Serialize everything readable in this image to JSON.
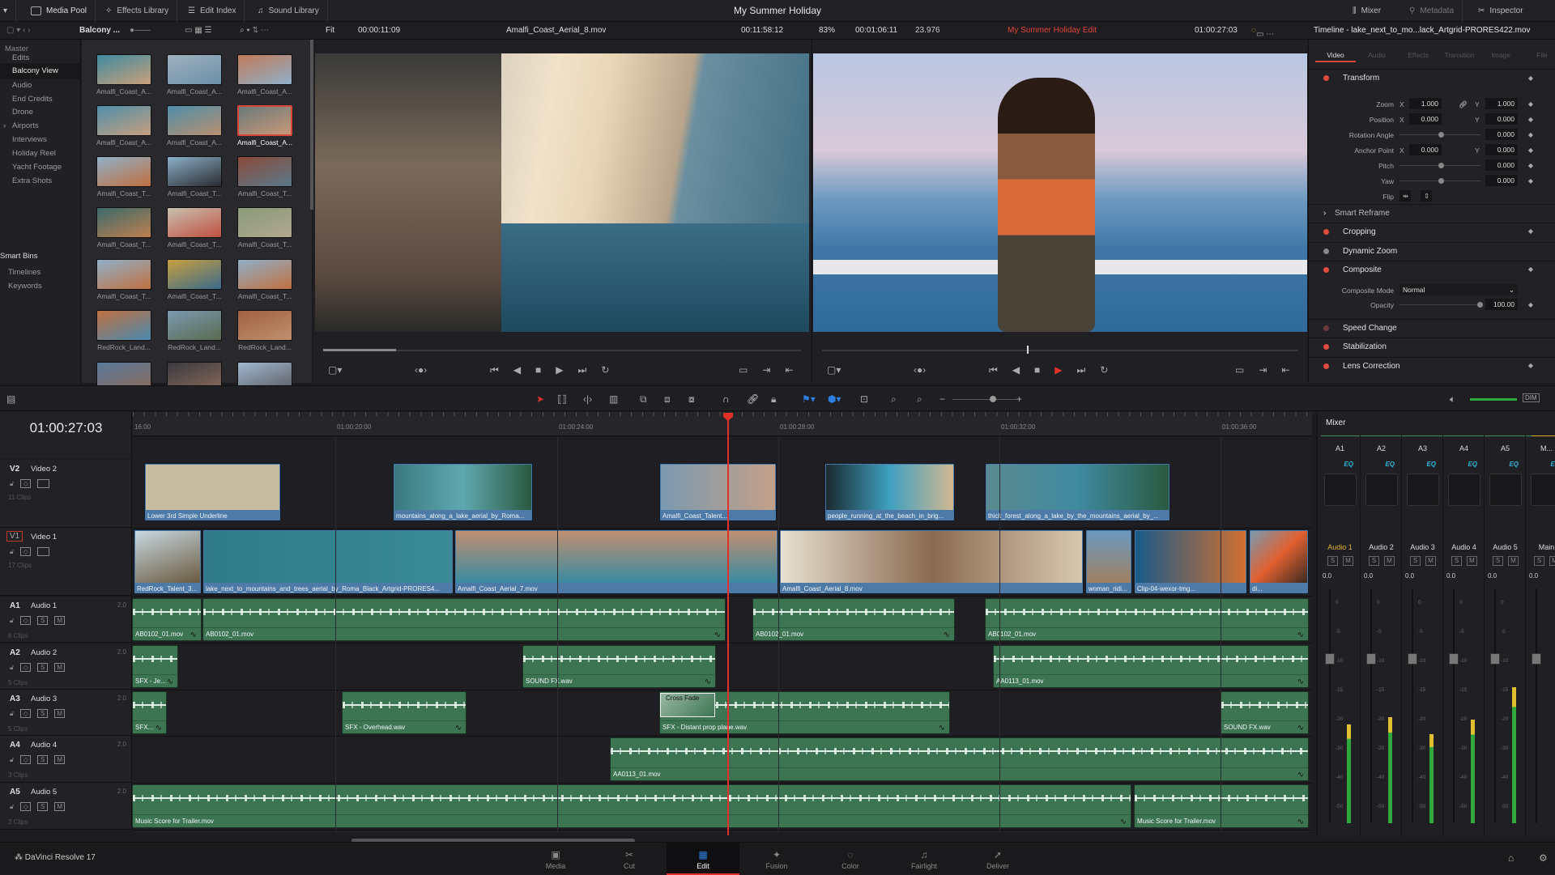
{
  "topbar": {
    "workspaces": [
      {
        "label": "Media Pool",
        "icon": "media-pool-icon"
      },
      {
        "label": "Effects Library",
        "icon": "effects-icon"
      },
      {
        "label": "Edit Index",
        "icon": "list-icon"
      },
      {
        "label": "Sound Library",
        "icon": "sound-icon"
      }
    ],
    "project_title": "My Summer Holiday",
    "right": [
      {
        "label": "Mixer",
        "icon": "mixer-icon"
      },
      {
        "label": "Metadata",
        "icon": "metadata-icon"
      },
      {
        "label": "Inspector",
        "icon": "inspector-icon"
      }
    ]
  },
  "toolbar2": {
    "bin_name": "Balcony ...",
    "source_zoom": "Fit",
    "source_duration": "00:00:11:09",
    "source_clip": "Amalfi_Coast_Aerial_8.mov",
    "source_timecode": "00:11:58:12",
    "program_zoom": "83%",
    "program_duration": "00:01:06:11",
    "frame_rate": "23.976",
    "timeline_name": "My Summer Holiday Edit",
    "program_timecode": "01:00:27:03",
    "inspector_title": "Timeline - lake_next_to_mo...lack_Artgrid-PRORES422.mov"
  },
  "bins": {
    "master": "Master",
    "items": [
      "Edits",
      "Balcony View",
      "Audio",
      "End Credits",
      "Drone",
      "Airports",
      "Interviews",
      "Holiday Reel",
      "Yacht Footage",
      "Extra Shots"
    ],
    "selected": "Balcony View",
    "smart_bins": "Smart Bins",
    "smart_items": [
      "Timelines",
      "Keywords"
    ]
  },
  "media_pool": {
    "clips": [
      "Amalfi_Coast_A...",
      "Amalfi_Coast_A...",
      "Amalfi_Coast_A...",
      "Amalfi_Coast_A...",
      "Amalfi_Coast_A...",
      "Amalfi_Coast_A...",
      "Amalfi_Coast_T...",
      "Amalfi_Coast_T...",
      "Amalfi_Coast_T...",
      "Amalfi_Coast_T...",
      "Amalfi_Coast_T...",
      "Amalfi_Coast_T...",
      "Amalfi_Coast_T...",
      "Amalfi_Coast_T...",
      "Amalfi_Coast_T...",
      "RedRock_Land...",
      "RedRock_Land...",
      "RedRock_Land..."
    ],
    "selected_index": 5
  },
  "inspector": {
    "tabs": [
      "Video",
      "Audio",
      "Effects",
      "Transition",
      "Image",
      "File"
    ],
    "active_tab": "Video",
    "transform": {
      "title": "Transform",
      "zoom_label": "Zoom",
      "zoom_x": "1.000",
      "zoom_y": "1.000",
      "position_label": "Position",
      "position_x": "0.000",
      "position_y": "0.000",
      "rotation_label": "Rotation Angle",
      "rotation": "0.000",
      "anchor_label": "Anchor Point",
      "anchor_x": "0.000",
      "anchor_y": "0.000",
      "pitch_label": "Pitch",
      "pitch": "0.000",
      "yaw_label": "Yaw",
      "yaw": "0.000",
      "flip_label": "Flip",
      "x": "X",
      "y": "Y"
    },
    "smart_reframe": "Smart Reframe",
    "cropping": "Cropping",
    "dynamic_zoom": "Dynamic Zoom",
    "composite": {
      "title": "Composite",
      "mode_label": "Composite Mode",
      "mode": "Normal",
      "opacity_label": "Opacity",
      "opacity": "100.00"
    },
    "speed_change": "Speed Change",
    "stabilization": "Stabilization",
    "lens_correction": "Lens Correction"
  },
  "timeline": {
    "timecode": "01:00:27:03",
    "ruler": [
      "16:00",
      "01:00:20:00",
      "01:00:24:00",
      "01:00:28:00",
      "01:00:32:00",
      "01:00:36:00"
    ],
    "tracks": [
      {
        "id": "V2",
        "name": "Video 2",
        "clips_count": "11 Clips",
        "channels": "",
        "clips": [
          "Lower 3rd Simple Underline",
          "mountains_along_a_lake_aerial_by_Roma...",
          "Amalfi_Coast_Talent...",
          "people_running_at_the_beach_in_brig...",
          "thick_forest_along_a_lake_by_the_mountains_aerial_by_..."
        ]
      },
      {
        "id": "V1",
        "name": "Video 1",
        "clips_count": "17 Clips",
        "channels": "",
        "clips": [
          "RedRock_Talent_3...",
          "lake_next_to_mountains_and_trees_aerial_by_Roma_Black_Artgrid-PRORES4...",
          "Amalfi_Coast_Aerial_7.mov",
          "Amalfi_Coast_Aerial_8.mov",
          "woman_ridi...",
          "Clip-04-wexor-tmg...",
          "di..."
        ]
      },
      {
        "id": "A1",
        "name": "Audio 1",
        "clips_count": "8 Clips",
        "channels": "2.0",
        "clips": [
          "AB0102_01.mov",
          "AB0102_01.mov",
          "AB0102_01.mov",
          "AB0102_01.mov"
        ]
      },
      {
        "id": "A2",
        "name": "Audio 2",
        "clips_count": "5 Clips",
        "channels": "2.0",
        "clips": [
          "SFX - Je...",
          "SOUND FX.wav",
          "AA0113_01.mov"
        ]
      },
      {
        "id": "A3",
        "name": "Audio 3",
        "clips_count": "5 Clips",
        "channels": "2.0",
        "clips": [
          "SFX...",
          "SFX - Overhead.wav",
          "SFX - Distant prop plane.wav",
          "SOUND FX.wav"
        ]
      },
      {
        "id": "A4",
        "name": "Audio 4",
        "clips_count": "3 Clips",
        "channels": "2.0",
        "clips": [
          "AA0113_01.mov"
        ]
      },
      {
        "id": "A5",
        "name": "Audio 5",
        "clips_count": "2 Clips",
        "channels": "2.0",
        "clips": [
          "Music Score for Trailer.mov",
          "Music Score for Trailer.mov"
        ]
      }
    ],
    "cross_fade": "Cross Fade",
    "solo": "S",
    "mute": "M"
  },
  "mixer": {
    "title": "Mixer",
    "channels": [
      {
        "id": "A1",
        "name": "Audio 1",
        "gain": "0.0",
        "level": 0.42
      },
      {
        "id": "A2",
        "name": "Audio 2",
        "gain": "0.0",
        "level": 0.45
      },
      {
        "id": "A3",
        "name": "Audio 3",
        "gain": "0.0",
        "level": 0.38
      },
      {
        "id": "A4",
        "name": "Audio 4",
        "gain": "0.0",
        "level": 0.44
      },
      {
        "id": "A5",
        "name": "Audio 5",
        "gain": "0.0",
        "level": 0.58
      },
      {
        "id": "M...",
        "name": "Main",
        "gain": "0.0",
        "level": 0
      }
    ],
    "eq": "EQ",
    "scale": [
      "0",
      "-5",
      "-10",
      "-15",
      "-20",
      "-30",
      "-40",
      "-50"
    ],
    "accent": "#e0b030"
  },
  "pages": {
    "app": "DaVinci Resolve 17",
    "items": [
      {
        "label": "Media",
        "icon": "media-page-icon"
      },
      {
        "label": "Cut",
        "icon": "cut-page-icon"
      },
      {
        "label": "Edit",
        "icon": "edit-page-icon"
      },
      {
        "label": "Fusion",
        "icon": "fusion-page-icon"
      },
      {
        "label": "Color",
        "icon": "color-page-icon"
      },
      {
        "label": "Fairlight",
        "icon": "fairlight-page-icon"
      },
      {
        "label": "Deliver",
        "icon": "deliver-page-icon"
      }
    ],
    "active": "Edit"
  },
  "colors": {
    "accent_red": "#e0302a",
    "video_clip": "#4d7aa6",
    "audio_clip": "#3d7553",
    "eq": "#2bb5d8"
  }
}
